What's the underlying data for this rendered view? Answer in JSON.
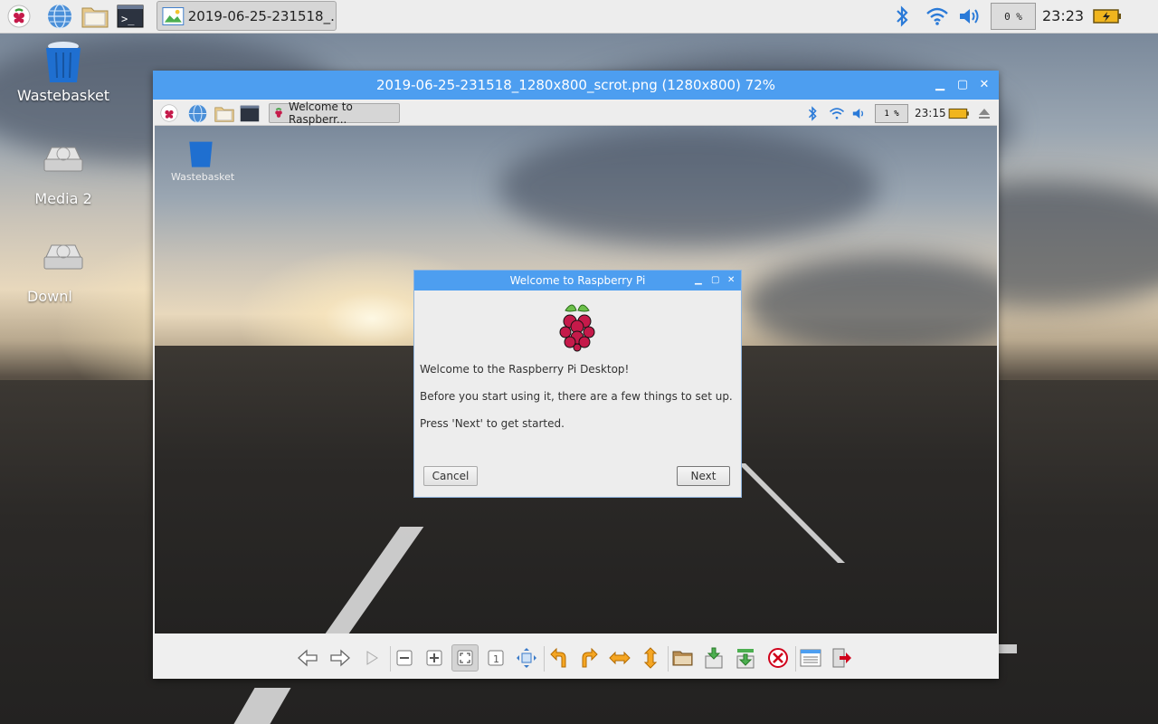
{
  "panel": {
    "menu_icon": "raspberry-icon",
    "launchers": [
      "browser-icon",
      "file-manager-icon",
      "terminal-icon"
    ],
    "task_title": "2019-06-25-231518_...",
    "cpu": "0 %",
    "clock": "23:23"
  },
  "desktop": {
    "icons": [
      {
        "label": "Wastebasket"
      },
      {
        "label": "Media 2"
      },
      {
        "label": "Downl"
      }
    ]
  },
  "viewer": {
    "title": "2019-06-25-231518_1280x800_scrot.png (1280x800) 72%",
    "controls": {
      "minimize": "▁",
      "maximize": "▢",
      "close": "✕"
    }
  },
  "screenshot": {
    "panel": {
      "task_title": "Welcome to Raspberr...",
      "cpu": "1 %",
      "clock": "23:15"
    },
    "wastebasket_label": "Wastebasket",
    "dialog": {
      "title": "Welcome to Raspberry Pi",
      "line1": "Welcome to the Raspberry Pi Desktop!",
      "line2": "Before you start using it, there are a few things to set up.",
      "line3": "Press 'Next' to get started.",
      "cancel": "Cancel",
      "next": "Next"
    }
  },
  "colors": {
    "accent": "#4d9ef0",
    "panel": "#ededed"
  }
}
